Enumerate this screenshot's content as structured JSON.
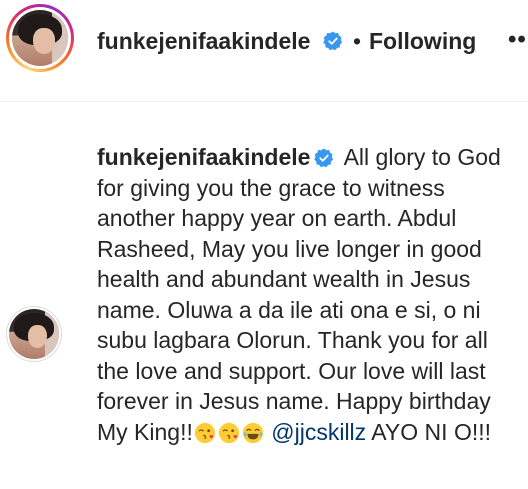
{
  "post_header": {
    "username": "funkejenifaakindele",
    "separator": "•",
    "follow_status": "Following",
    "more_label": "••"
  },
  "caption": {
    "username": "funkejenifaakindele",
    "text_main": "All glory to God for giving you the grace to witness another happy year on earth. Abdul Rasheed, May you live longer in good health and abundant wealth in Jesus name. Oluwa a da ile ati ona e si, o ni subu lagbara Olorun. Thank you for all the love and support. Our love will last forever in Jesus name. Happy birthday My King!!",
    "emojis": [
      "kiss-wink-emoji",
      "kiss-wink-emoji",
      "tears-of-joy-emoji"
    ],
    "mention": "@jjcskillz",
    "text_end": "AYO NI O!!!"
  },
  "colors": {
    "verified_blue": "#3897f0",
    "mention_blue": "#00376b",
    "text": "#262626"
  }
}
